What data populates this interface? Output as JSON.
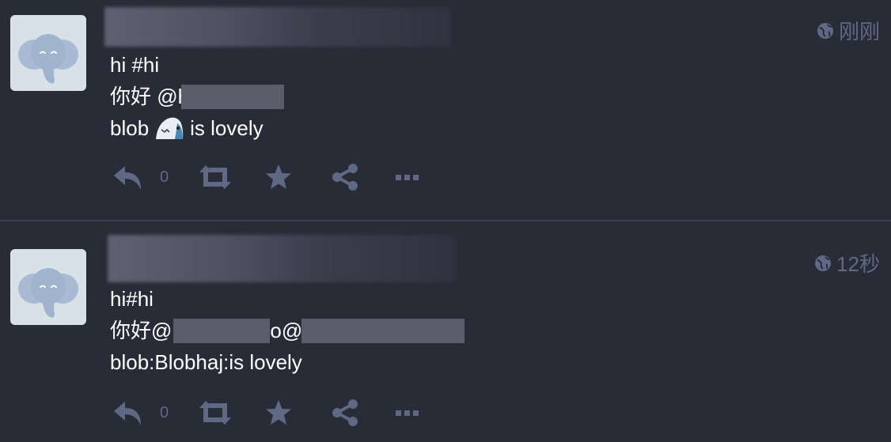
{
  "statuses": [
    {
      "timestamp": "刚刚",
      "visibility_icon": "globe-icon",
      "lines": {
        "l1": "hi #hi",
        "l2_prefix": "你好 @h",
        "l3_before": "blob ",
        "l3_after": " is lovely"
      },
      "reply_count": "0"
    },
    {
      "timestamp": "12秒",
      "visibility_icon": "globe-icon",
      "lines": {
        "l1": "hi#hi",
        "l2_part1": "你好@",
        "l2_part2": "o@c",
        "l3": "blob:Blobhaj:is lovely"
      },
      "reply_count": "0"
    }
  ],
  "icons": [
    "reply-icon",
    "boost-icon",
    "star-icon",
    "share-icon",
    "more-icon"
  ],
  "colors": {
    "background": "#282c37",
    "muted": "#606984",
    "text": "#ffffff",
    "avatar_bg": "#d9e1e8"
  }
}
